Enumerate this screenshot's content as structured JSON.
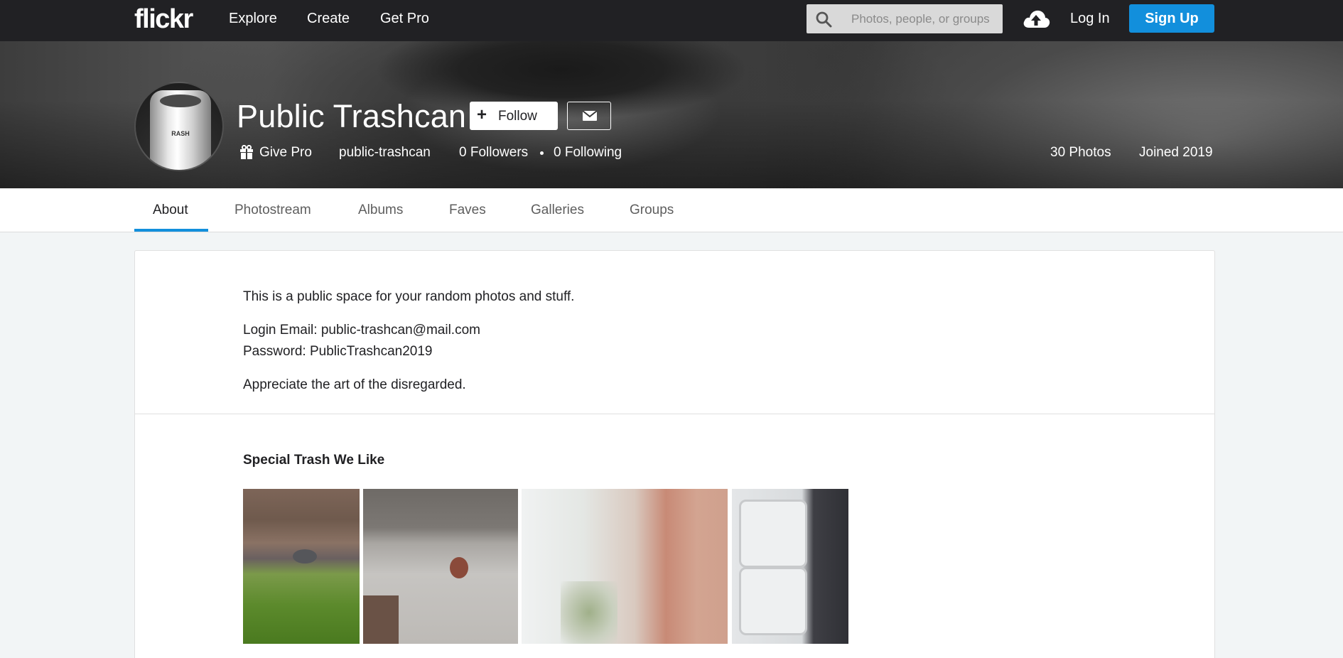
{
  "topnav": {
    "logo": "flickr",
    "links": [
      "Explore",
      "Create",
      "Get Pro"
    ],
    "search_placeholder": "Photos, people, or groups",
    "login": "Log In",
    "signup": "Sign Up"
  },
  "profile": {
    "name": "Public Trashcan",
    "avatar_text": "RASH",
    "follow_label": "Follow",
    "give_pro": "Give Pro",
    "username": "public-trashcan",
    "followers": "0 Followers",
    "following": "0 Following",
    "photos": "30 Photos",
    "joined": "Joined 2019"
  },
  "tabs": [
    "About",
    "Photostream",
    "Albums",
    "Faves",
    "Galleries",
    "Groups"
  ],
  "about": {
    "lines": [
      "This is a public space for your random photos and stuff.",
      "Login Email: public-trashcan@mail.com",
      "Password: PublicTrashcan2019",
      "Appreciate the art of the disregarded."
    ]
  },
  "showcase": {
    "title": "Special Trash We Like"
  },
  "colors": {
    "accent": "#128fdc",
    "nav_bg": "#212124",
    "page_bg": "#f2f5f6"
  }
}
